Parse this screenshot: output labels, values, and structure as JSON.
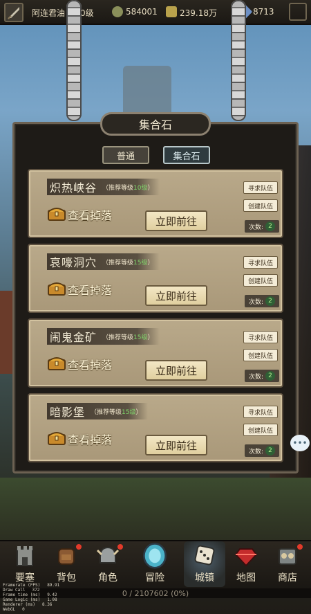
{
  "topbar": {
    "player_name": "阿连君油",
    "level_suffix": "0级",
    "currency1": "584001",
    "currency2": "239.18万",
    "currency3": "8713"
  },
  "panel": {
    "title": "集合石",
    "tabs": [
      {
        "label": "普通",
        "active": false
      },
      {
        "label": "集合石",
        "active": true
      }
    ]
  },
  "dungeons": [
    {
      "name": "炽热峡谷",
      "level_prefix": "（推荐等级",
      "level": "10级",
      "level_suffix": "）",
      "drops": "查看掉落",
      "go": "立即前往",
      "seek": "寻求队伍",
      "create": "创建队伍",
      "count_label": "次数:",
      "count": "2"
    },
    {
      "name": "哀嚎洞穴",
      "level_prefix": "（推荐等级",
      "level": "15级",
      "level_suffix": "）",
      "drops": "查看掉落",
      "go": "立即前往",
      "seek": "寻求队伍",
      "create": "创建队伍",
      "count_label": "次数:",
      "count": "2"
    },
    {
      "name": "闹鬼金矿",
      "level_prefix": "（推荐等级",
      "level": "15级",
      "level_suffix": "）",
      "drops": "查看掉落",
      "go": "立即前往",
      "seek": "寻求队伍",
      "create": "创建队伍",
      "count_label": "次数:",
      "count": "2"
    },
    {
      "name": "暗影堡",
      "level_prefix": "（推荐等级",
      "level": "15级",
      "level_suffix": "）",
      "drops": "查看掉落",
      "go": "立即前往",
      "seek": "寻求队伍",
      "create": "创建队伍",
      "count_label": "次数:",
      "count": "2"
    }
  ],
  "bottom_nav": [
    {
      "label": "要塞",
      "icon": "fortress-icon"
    },
    {
      "label": "背包",
      "icon": "backpack-icon"
    },
    {
      "label": "角色",
      "icon": "helmet-icon"
    },
    {
      "label": "冒险",
      "icon": "portal-icon"
    },
    {
      "label": "城镇",
      "icon": "dice-icon",
      "active": true
    },
    {
      "label": "地图",
      "icon": "gem-icon"
    },
    {
      "label": "商店",
      "icon": "shop-icon"
    }
  ],
  "progress": {
    "text": "0 / 2107602 (0%)",
    "fraction": 0
  },
  "perf": [
    {
      "label": "Framerate (FPS)",
      "value": "89.91"
    },
    {
      "label": "Draw Call",
      "value": "372"
    },
    {
      "label": "Frame time (ms)",
      "value": "9.42"
    },
    {
      "label": "Game Logic (ms)",
      "value": "1.08"
    },
    {
      "label": "Renderer (ms)",
      "value": "8.36"
    },
    {
      "label": "WebGL",
      "value": "0"
    }
  ],
  "colors": {
    "level_green": "#7fd46a",
    "card_bg": "#b9a98a",
    "panel_bg": "#1e1b17"
  }
}
